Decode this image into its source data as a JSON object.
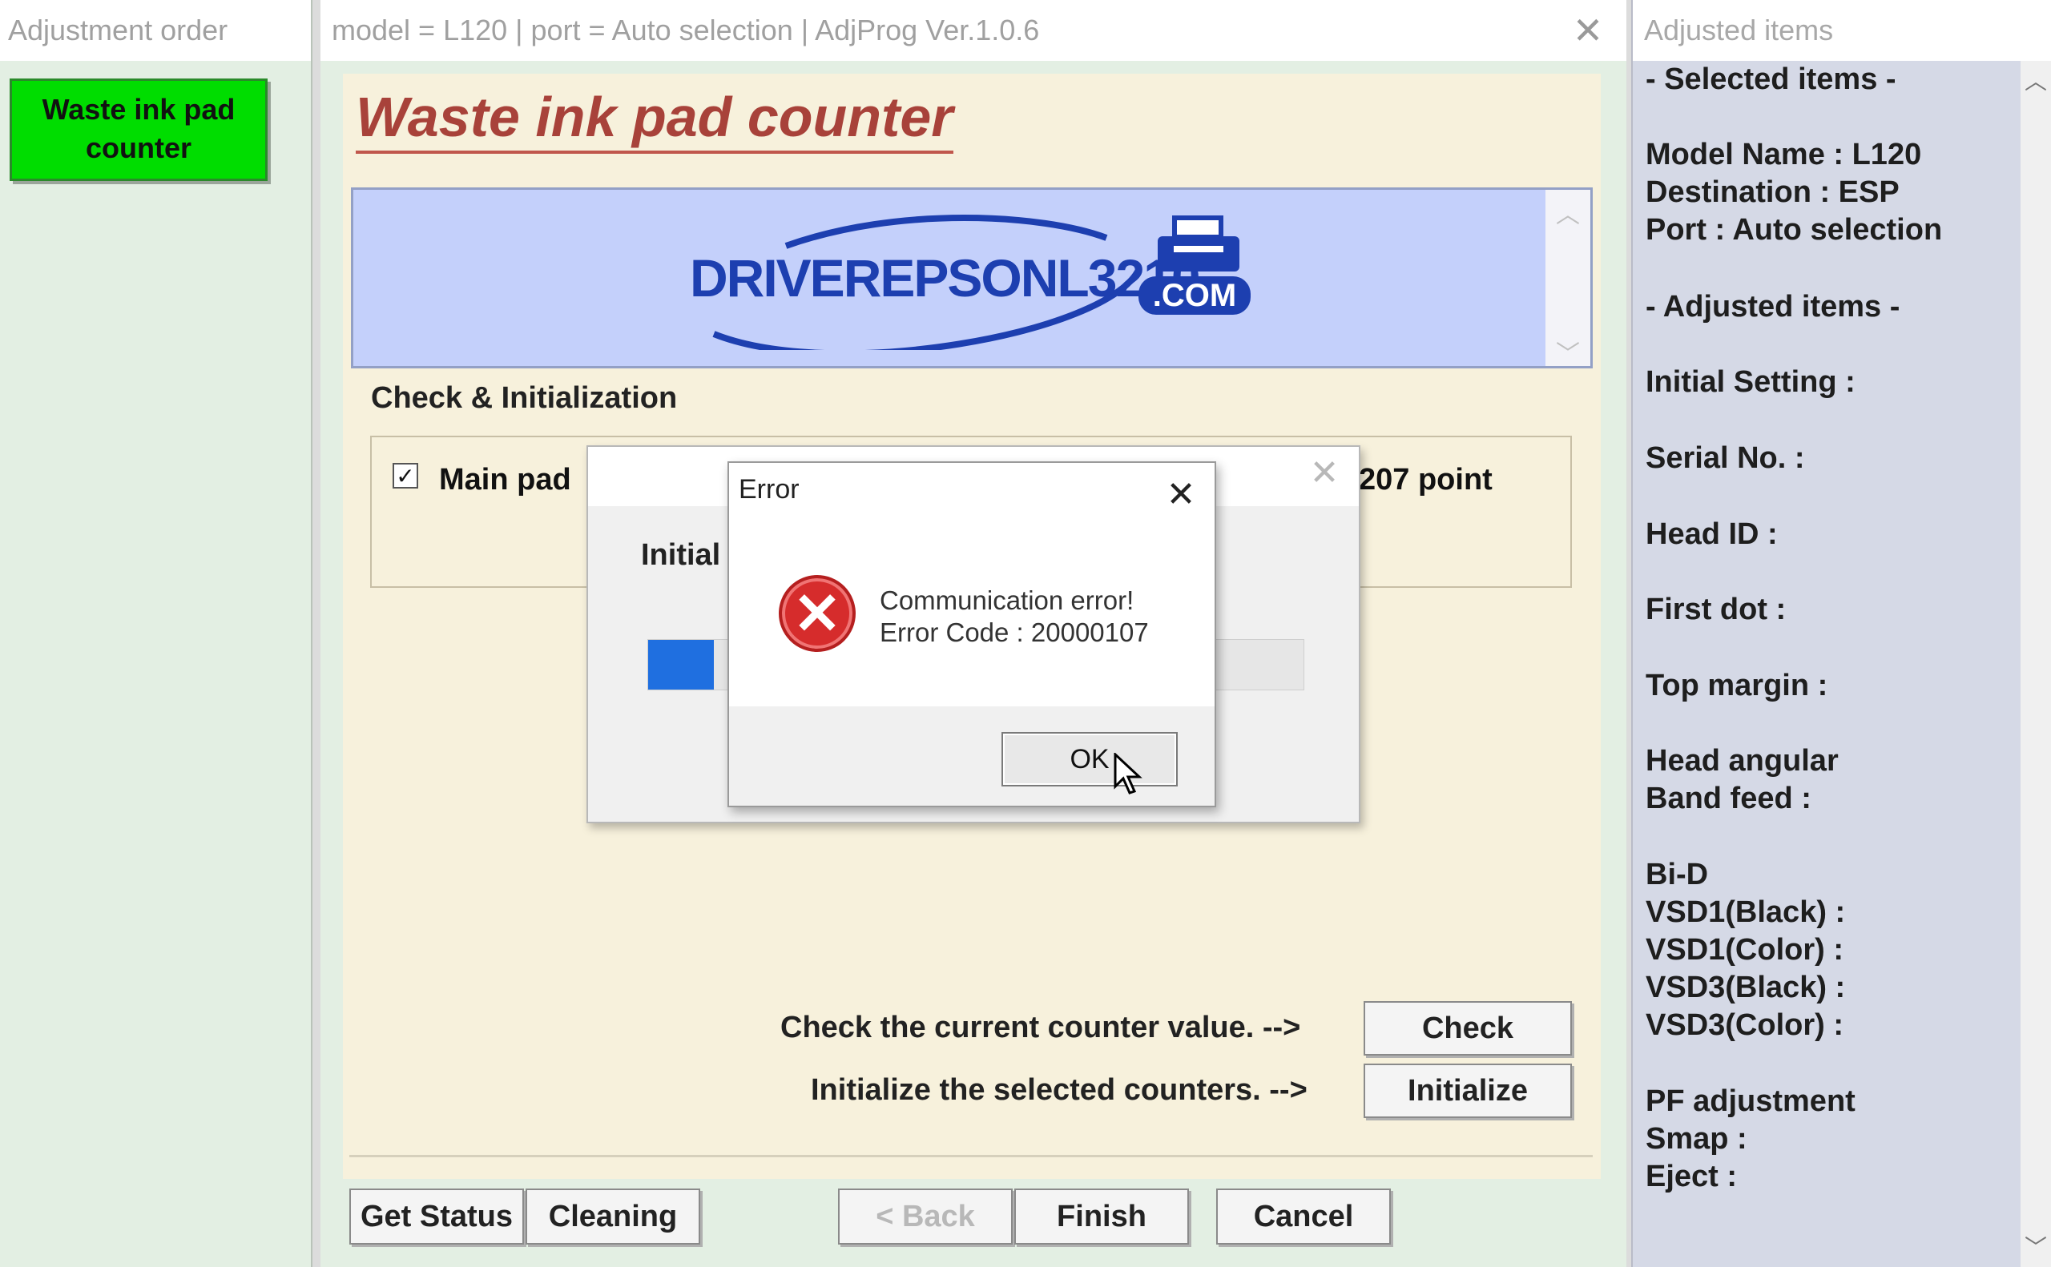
{
  "left_panel": {
    "title": "Adjustment order",
    "items": [
      "Waste ink pad",
      "counter"
    ]
  },
  "main_window": {
    "title": "model = L120 | port = Auto selection | AdjProg Ver.1.0.6",
    "heading": "Waste ink pad counter",
    "banner": {
      "logo_text": "DRIVEREPSONL3210",
      "logo_suffix": ".COM"
    },
    "group_label": "Check & Initialization",
    "counter_row": {
      "checked": true,
      "label": "Main pad",
      "value_suffix": "207 point"
    },
    "check_row": {
      "label": "Check the current counter value. -->",
      "button": "Check"
    },
    "init_row": {
      "label": "Initialize the selected counters. -->",
      "button": "Initialize"
    },
    "bottom_buttons": {
      "get_status": "Get Status",
      "cleaning": "Cleaning",
      "back": "< Back",
      "finish": "Finish",
      "cancel": "Cancel"
    }
  },
  "progress_dialog": {
    "text": "Initial",
    "progress": 0.1
  },
  "error_dialog": {
    "title": "Error",
    "message_line1": "Communication error!",
    "message_line2": "Error Code : 20000107",
    "ok": "OK"
  },
  "right_panel": {
    "title": "Adjusted items",
    "selected_header": "- Selected items -",
    "model_name": "Model Name : L120",
    "destination": "Destination : ESP",
    "port": "Port : Auto selection",
    "adjusted_header": "- Adjusted items -",
    "initial_setting": "Initial Setting :",
    "serial_no": "Serial No. :",
    "head_id": "Head ID :",
    "first_dot": "First dot :",
    "top_margin": "Top margin :",
    "head_angular": "Head angular",
    "band_feed": " Band feed :",
    "bid": "Bi-D",
    "vsd1_black": " VSD1(Black) :",
    "vsd1_color": " VSD1(Color) :",
    "vsd3_black": " VSD3(Black) :",
    "vsd3_color": " VSD3(Color) :",
    "pf_adjustment": "PF adjustment",
    "smap": "Smap :",
    "eject": "Eject :"
  },
  "colors": {
    "accent_green": "#00dd00",
    "heading_red": "#a8423a",
    "banner_blue": "#c4d0fb",
    "progress_blue": "#1f6fe0",
    "error_red": "#d62c2c"
  },
  "icons": [
    "close-icon",
    "error-icon",
    "scroll-up-icon",
    "scroll-down-icon",
    "printer-icon",
    "checkmark-icon",
    "mouse-cursor-icon"
  ]
}
